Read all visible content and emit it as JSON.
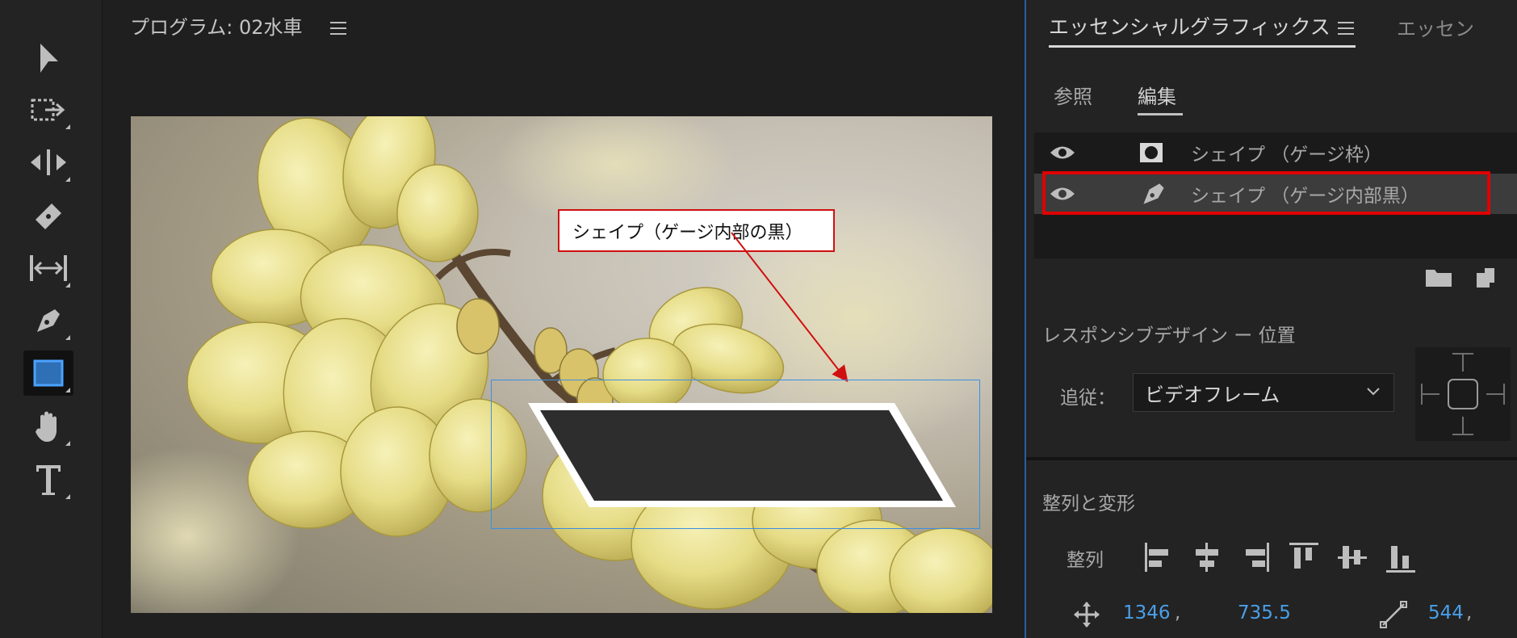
{
  "toolbar": {
    "tools": [
      {
        "name": "selection-tool",
        "icon": "arrow-icon"
      },
      {
        "name": "track-select-tool",
        "icon": "track-select-icon"
      },
      {
        "name": "ripple-edit-tool",
        "icon": "ripple-edit-icon"
      },
      {
        "name": "razor-tool",
        "icon": "razor-icon"
      },
      {
        "name": "slip-tool",
        "icon": "slip-icon"
      },
      {
        "name": "pen-tool",
        "icon": "pen-icon"
      },
      {
        "name": "rectangle-tool",
        "icon": "rectangle-icon",
        "active": true
      },
      {
        "name": "hand-tool",
        "icon": "hand-icon"
      },
      {
        "name": "type-tool",
        "icon": "type-icon"
      }
    ]
  },
  "monitor": {
    "title": "プログラム: 02水車",
    "callout_text": "シェイプ（ゲージ内部の黒）",
    "accent_color": "#3b8fe0",
    "callout_border_color": "#d01010"
  },
  "panel": {
    "tab_active": "エッセンシャルグラフィックス",
    "tab_other": "エッセン",
    "subtabs": {
      "browse": "参照",
      "edit": "編集"
    },
    "layers": [
      {
        "label": "シェイプ （ゲージ枠）",
        "icon": "shape-mask-icon",
        "selected": false
      },
      {
        "label": "シェイプ （ゲージ内部黒）",
        "icon": "pen-icon",
        "selected": true
      }
    ],
    "responsive_title": "レスポンシブデザイン ー 位置",
    "follow_label": "追従：",
    "follow_value": "ビデオフレーム",
    "align_section_title": "整列と変形",
    "align_label": "整列",
    "position_x": "1346",
    "position_y": "735.5",
    "anchor_x": "544",
    "highlight_color": "#e00000"
  }
}
